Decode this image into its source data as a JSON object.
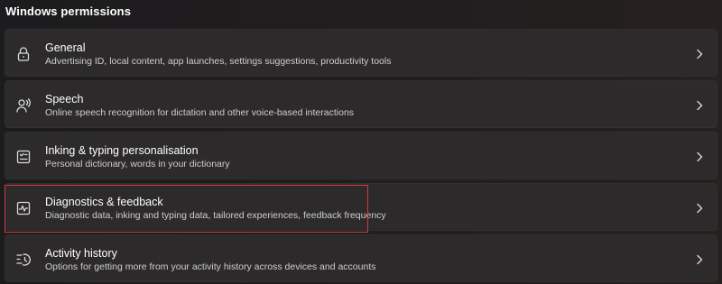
{
  "section": {
    "title": "Windows permissions"
  },
  "items": [
    {
      "icon": "lock-icon",
      "title": "General",
      "subtitle": "Advertising ID, local content, app launches, settings suggestions, productivity tools"
    },
    {
      "icon": "speech-icon",
      "title": "Speech",
      "subtitle": "Online speech recognition for dictation and other voice-based interactions"
    },
    {
      "icon": "inking-typing-icon",
      "title": "Inking & typing personalisation",
      "subtitle": "Personal dictionary, words in your dictionary"
    },
    {
      "icon": "diagnostics-icon",
      "title": "Diagnostics & feedback",
      "subtitle": "Diagnostic data, inking and typing data, tailored experiences, feedback frequency"
    },
    {
      "icon": "activity-history-icon",
      "title": "Activity history",
      "subtitle": "Options for getting more from your activity history across devices and accounts"
    }
  ],
  "highlight": {
    "color": "#d33a3a",
    "target": "Diagnostics & feedback"
  }
}
